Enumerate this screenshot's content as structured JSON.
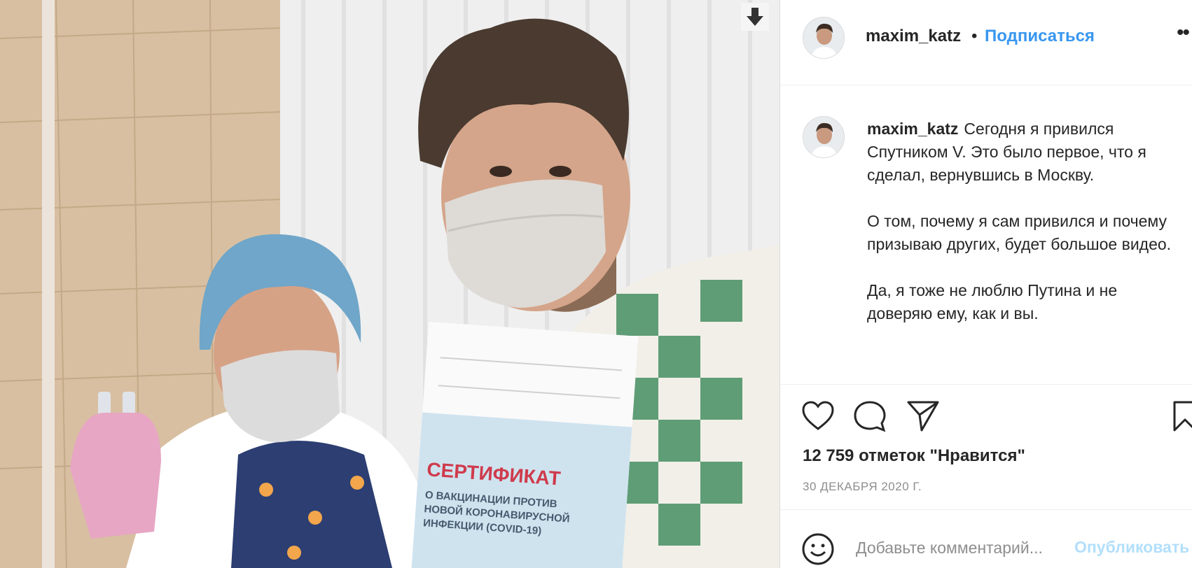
{
  "photo": {
    "certificate_title": "СЕРТИФИКАТ",
    "certificate_subtitle": [
      "О ВАКЦИНАЦИИ ПРОТИВ",
      "НОВОЙ КОРОНАВИРУСНОЙ",
      "ИНФЕКЦИИ (COVID-19)"
    ],
    "download_icon": "arrow-down-icon"
  },
  "header": {
    "username": "maxim_katz",
    "separator": "•",
    "follow_label": "Подписаться",
    "more_label": "••"
  },
  "caption": {
    "username": "maxim_katz",
    "paragraphs": [
      "Сегодня я привился Спутником V. Это было первое, что я сделал, вернувшись в Москву.",
      "О том, почему я сам привился и почему призываю других, будет большое видео.",
      "Да, я тоже не люблю Путина и не доверяю ему, как и вы."
    ]
  },
  "actions": {
    "like_icon": "heart-icon",
    "comment_icon": "comment-icon",
    "share_icon": "share-icon",
    "save_icon": "bookmark-icon",
    "likes_text": "12 759 отметок \"Нравится\"",
    "date": "30 ДЕКАБРЯ 2020 Г."
  },
  "comment": {
    "placeholder": "Добавьте комментарий...",
    "publish_label": "Опубликовать",
    "emoji_icon": "smiley-icon"
  }
}
